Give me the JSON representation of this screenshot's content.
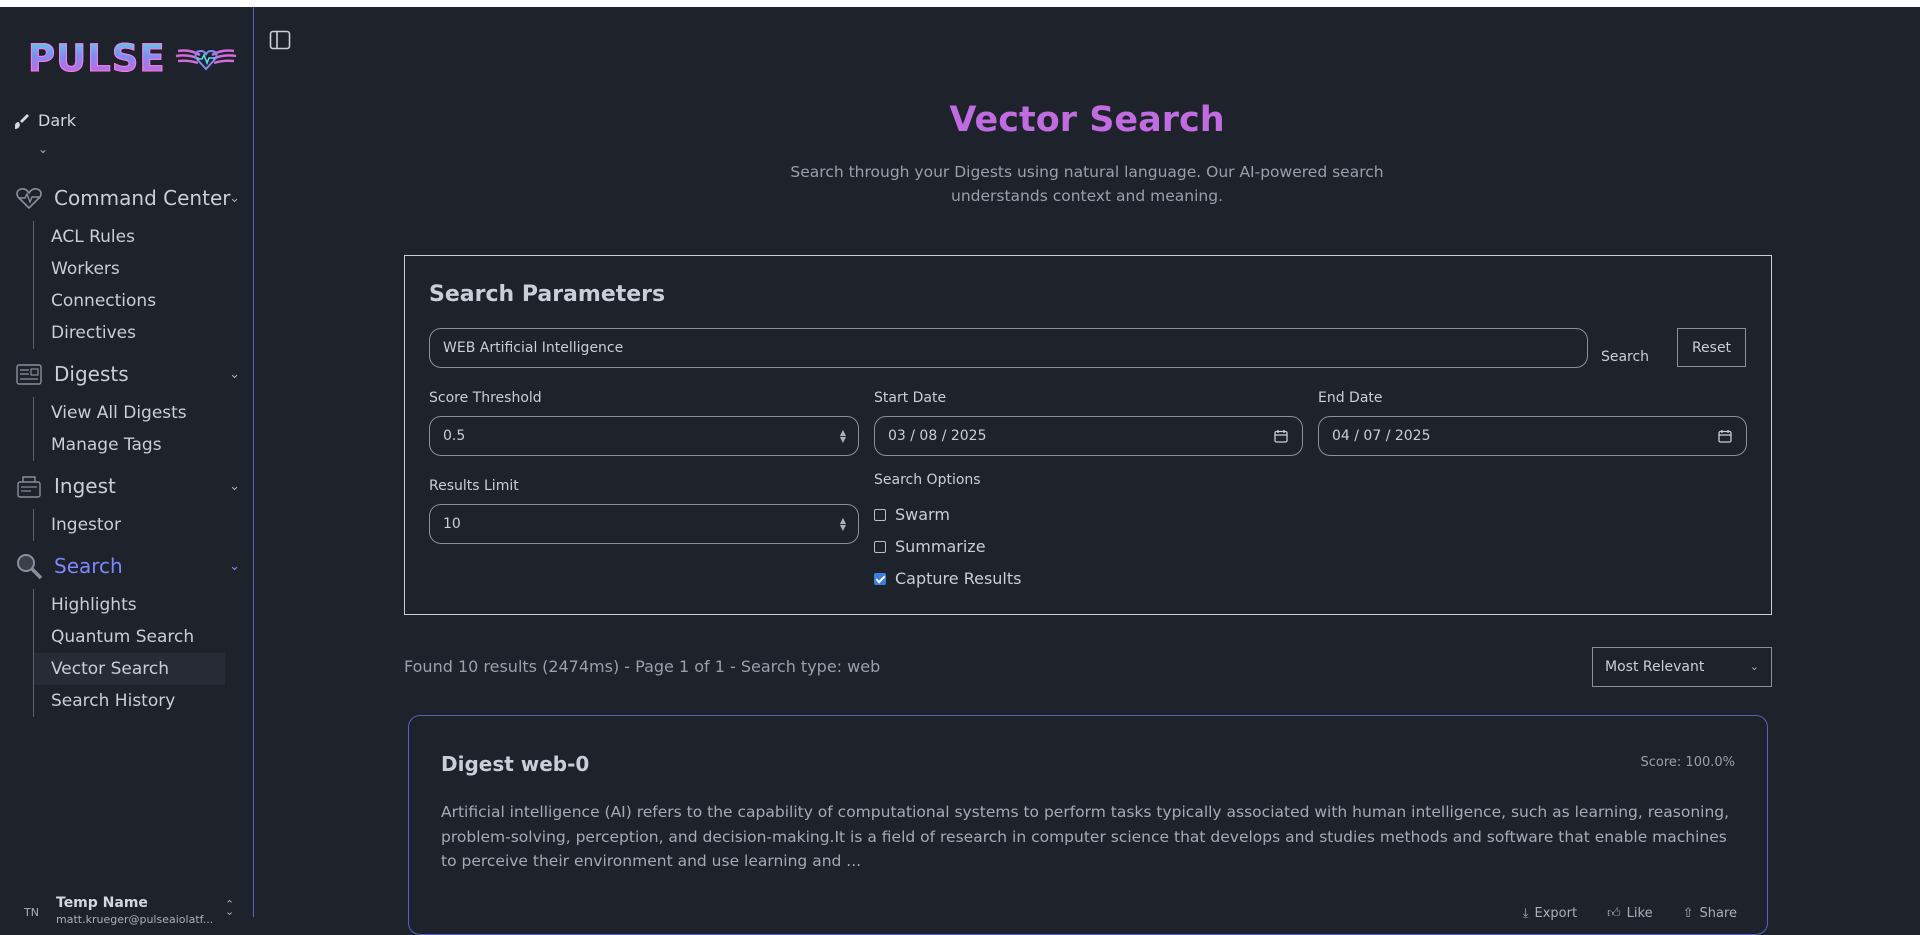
{
  "app": {
    "logo_text": "PULSE"
  },
  "theme": {
    "label": "Dark"
  },
  "sidebar": {
    "sections": [
      {
        "label": "Command Center",
        "items": [
          "ACL Rules",
          "Workers",
          "Connections",
          "Directives"
        ]
      },
      {
        "label": "Digests",
        "items": [
          "View All Digests",
          "Manage Tags"
        ]
      },
      {
        "label": "Ingest",
        "items": [
          "Ingestor"
        ]
      },
      {
        "label": "Search",
        "items": [
          "Highlights",
          "Quantum Search",
          "Vector Search",
          "Search History"
        ]
      }
    ],
    "active_section": "Search",
    "active_item": "Vector Search"
  },
  "user": {
    "initials": "TN",
    "name": "Temp Name",
    "email": "matt.krueger@pulseaiolatf..."
  },
  "page": {
    "title": "Vector Search",
    "subtitle": "Search through your Digests using natural language. Our AI-powered search understands context and meaning."
  },
  "params": {
    "heading": "Search Parameters",
    "query": "WEB Artificial Intelligence",
    "search_label": "Search",
    "reset_label": "Reset",
    "score_label": "Score Threshold",
    "score_value": "0.5",
    "start_label": "Start Date",
    "start_value": "03 / 08 / 2025",
    "end_label": "End Date",
    "end_value": "04 / 07 / 2025",
    "limit_label": "Results Limit",
    "limit_value": "10",
    "options_label": "Search Options",
    "options": [
      {
        "label": "Swarm",
        "checked": false
      },
      {
        "label": "Summarize",
        "checked": false
      },
      {
        "label": "Capture Results",
        "checked": true
      }
    ]
  },
  "results": {
    "summary": "Found 10 results (2474ms) - Page 1 of 1 - Search type: web",
    "sort_value": "Most Relevant",
    "items": [
      {
        "title": "Digest web-0",
        "score": "Score: 100.0%",
        "text": "Artificial intelligence (AI) refers to the capability of computational systems to perform tasks typically associated with human intelligence, such as learning, reasoning, problem-solving, perception, and decision-making.It is a field of research in computer science that develops and studies methods and software that enable machines to perceive their environment and use learning and ...",
        "actions": [
          "Export",
          "Like",
          "Share"
        ]
      }
    ]
  },
  "colors": {
    "accent": "#7f86ff",
    "title": "#c06be0",
    "background": "#1d222b",
    "checkbox": "#3b7fe0"
  }
}
